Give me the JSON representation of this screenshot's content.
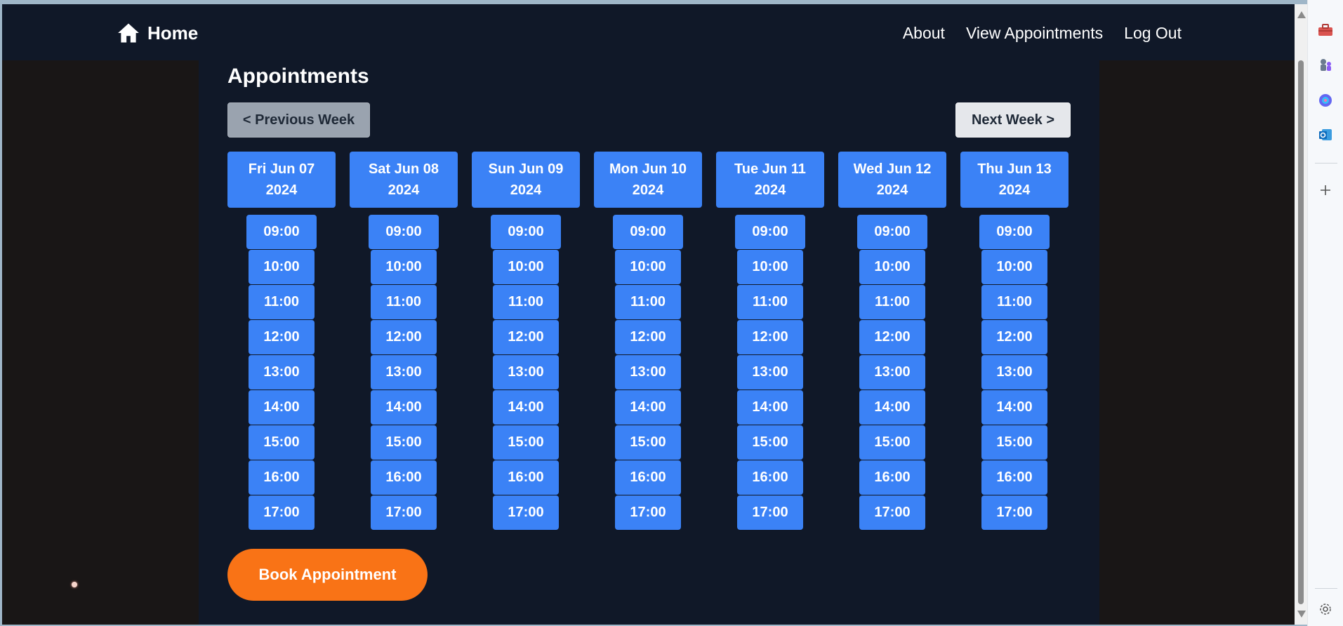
{
  "nav": {
    "home_label": "Home",
    "links": [
      "About",
      "View Appointments",
      "Log Out"
    ]
  },
  "page": {
    "title": "Appointments",
    "prev_week": "< Previous Week",
    "next_week": "Next Week >",
    "book_button": "Book Appointment"
  },
  "days": [
    {
      "label": "Fri Jun 07",
      "year": "2024"
    },
    {
      "label": "Sat Jun 08",
      "year": "2024"
    },
    {
      "label": "Sun Jun 09",
      "year": "2024"
    },
    {
      "label": "Mon Jun 10",
      "year": "2024"
    },
    {
      "label": "Tue Jun 11",
      "year": "2024"
    },
    {
      "label": "Wed Jun 12",
      "year": "2024"
    },
    {
      "label": "Thu Jun 13",
      "year": "2024"
    }
  ],
  "slots": [
    "09:00",
    "10:00",
    "11:00",
    "12:00",
    "13:00",
    "14:00",
    "15:00",
    "16:00",
    "17:00"
  ],
  "side_panel": {
    "icons": [
      "toolbox-icon",
      "chess-icon",
      "copilot-icon",
      "outlook-icon",
      "add-icon",
      "settings-icon"
    ]
  },
  "colors": {
    "accent": "#3b82f6",
    "cta": "#f97316",
    "background": "#101828"
  }
}
